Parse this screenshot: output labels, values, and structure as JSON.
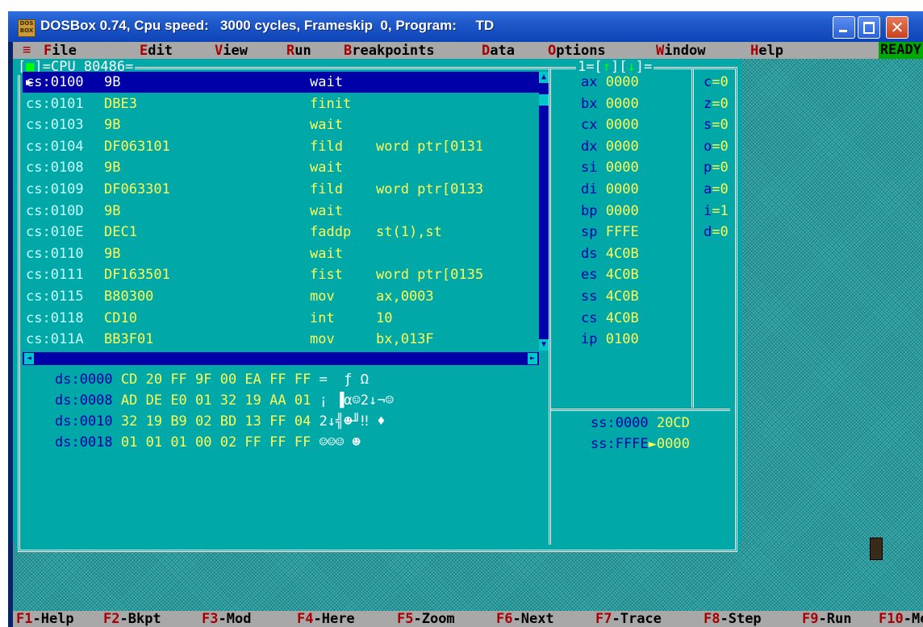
{
  "window": {
    "title": "DOSBox 0.74, Cpu speed:   3000 cycles, Frameskip  0, Program:     TD",
    "icon_label": "DOS BOX",
    "close_glyph": "✕"
  },
  "menu": {
    "system": "≡",
    "items": [
      {
        "hot": "F",
        "rest": "ile"
      },
      {
        "hot": "E",
        "rest": "dit"
      },
      {
        "hot": "V",
        "rest": "iew"
      },
      {
        "hot": "R",
        "rest": "un"
      },
      {
        "hot": "B",
        "rest": "reakpoints"
      },
      {
        "hot": "D",
        "rest": "ata"
      },
      {
        "hot": "O",
        "rest": "ptions"
      },
      {
        "hot": "W",
        "rest": "indow"
      },
      {
        "hot": "H",
        "rest": "elp"
      }
    ],
    "status": "READY"
  },
  "cpu_window": {
    "title_pre": "[",
    "close_box": "■",
    "title_post": "]=CPU 80486=",
    "num_pre": "1=[",
    "up_arrow": "↑",
    "num_mid": "][",
    "down_arrow": "↓",
    "num_post": "]="
  },
  "code": [
    {
      "addr": "cs:0100",
      "arrow": "►",
      "bytes": "9B",
      "mnemonic": "wait",
      "operand": ""
    },
    {
      "addr": "cs:0101",
      "arrow": "",
      "bytes": "DBE3",
      "mnemonic": "finit",
      "operand": ""
    },
    {
      "addr": "cs:0103",
      "arrow": "",
      "bytes": "9B",
      "mnemonic": "wait",
      "operand": ""
    },
    {
      "addr": "cs:0104",
      "arrow": "",
      "bytes": "DF063101",
      "mnemonic": "fild",
      "operand": "word ptr[0131"
    },
    {
      "addr": "cs:0108",
      "arrow": "",
      "bytes": "9B",
      "mnemonic": "wait",
      "operand": ""
    },
    {
      "addr": "cs:0109",
      "arrow": "",
      "bytes": "DF063301",
      "mnemonic": "fild",
      "operand": "word ptr[0133"
    },
    {
      "addr": "cs:010D",
      "arrow": "",
      "bytes": "9B",
      "mnemonic": "wait",
      "operand": ""
    },
    {
      "addr": "cs:010E",
      "arrow": "",
      "bytes": "DEC1",
      "mnemonic": "faddp",
      "operand": "st(1),st"
    },
    {
      "addr": "cs:0110",
      "arrow": "",
      "bytes": "9B",
      "mnemonic": "wait",
      "operand": ""
    },
    {
      "addr": "cs:0111",
      "arrow": "",
      "bytes": "DF163501",
      "mnemonic": "fist",
      "operand": "word ptr[0135"
    },
    {
      "addr": "cs:0115",
      "arrow": "",
      "bytes": "B80300",
      "mnemonic": "mov",
      "operand": "ax,0003"
    },
    {
      "addr": "cs:0118",
      "arrow": "",
      "bytes": "CD10",
      "mnemonic": "int",
      "operand": "10"
    },
    {
      "addr": "cs:011A",
      "arrow": "",
      "bytes": "BB3F01",
      "mnemonic": "mov",
      "operand": "bx,013F"
    }
  ],
  "registers": [
    {
      "name": "ax",
      "value": "0000"
    },
    {
      "name": "bx",
      "value": "0000"
    },
    {
      "name": "cx",
      "value": "0000"
    },
    {
      "name": "dx",
      "value": "0000"
    },
    {
      "name": "si",
      "value": "0000"
    },
    {
      "name": "di",
      "value": "0000"
    },
    {
      "name": "bp",
      "value": "0000"
    },
    {
      "name": "sp",
      "value": "FFFE"
    },
    {
      "name": "ds",
      "value": "4C0B"
    },
    {
      "name": "es",
      "value": "4C0B"
    },
    {
      "name": "ss",
      "value": "4C0B"
    },
    {
      "name": "cs",
      "value": "4C0B"
    },
    {
      "name": "ip",
      "value": "0100"
    }
  ],
  "flags": [
    {
      "name": "c",
      "value": "0"
    },
    {
      "name": "z",
      "value": "0"
    },
    {
      "name": "s",
      "value": "0"
    },
    {
      "name": "o",
      "value": "0"
    },
    {
      "name": "p",
      "value": "0"
    },
    {
      "name": "a",
      "value": "0"
    },
    {
      "name": "i",
      "value": "1"
    },
    {
      "name": "d",
      "value": "0"
    }
  ],
  "dump": [
    {
      "addr": "ds:0000",
      "bytes": "CD 20 FF 9F 00 EA FF FF",
      "ascii": "=  ƒ Ω"
    },
    {
      "addr": "ds:0008",
      "bytes": "AD DE E0 01 32 19 AA 01",
      "ascii": "¡ ▐α☺2↓¬☺"
    },
    {
      "addr": "ds:0010",
      "bytes": "32 19 B9 02 BD 13 FF 04",
      "ascii": "2↓╣☻╜‼ ♦"
    },
    {
      "addr": "ds:0018",
      "bytes": "01 01 01 00 02 FF FF FF",
      "ascii": "☺☺☺ ☻"
    }
  ],
  "stack": [
    {
      "addr": "ss:0000",
      "sep": " ",
      "value": "20CD"
    },
    {
      "addr": "ss:FFFE",
      "sep": "►",
      "value": "0000"
    }
  ],
  "fkeys": [
    {
      "key": "F1",
      "label": "-Help"
    },
    {
      "key": "F2",
      "label": "-Bkpt"
    },
    {
      "key": "F3",
      "label": "-Mod"
    },
    {
      "key": "F4",
      "label": "-Here"
    },
    {
      "key": "F5",
      "label": "-Zoom"
    },
    {
      "key": "F6",
      "label": "-Next"
    },
    {
      "key": "F7",
      "label": "-Trace"
    },
    {
      "key": "F8",
      "label": "-Step"
    },
    {
      "key": "F9",
      "label": "-Run"
    },
    {
      "key": "F10",
      "label": "-Menu"
    }
  ]
}
